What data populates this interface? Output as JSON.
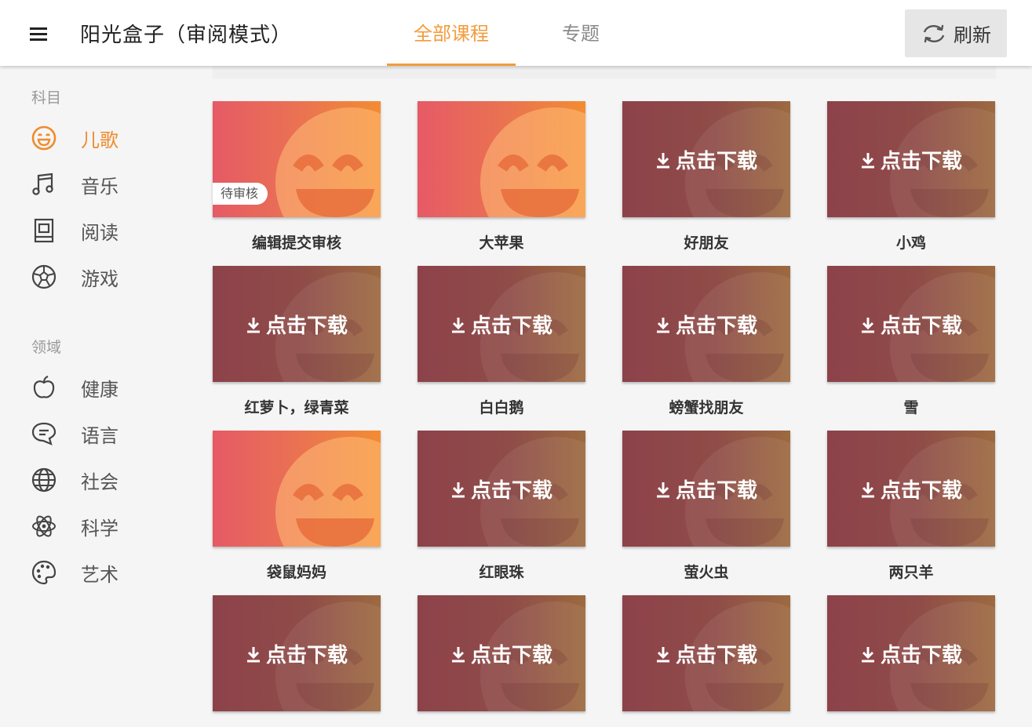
{
  "header": {
    "title": "阳光盒子（审阅模式）",
    "tabs": [
      {
        "label": "全部课程",
        "active": true
      },
      {
        "label": "专题",
        "active": false
      }
    ],
    "refresh_label": "刷新"
  },
  "sidebar": {
    "subjects_title": "科目",
    "subjects": [
      {
        "label": "儿歌",
        "icon": "smile-icon",
        "active": true
      },
      {
        "label": "音乐",
        "icon": "music-note-icon",
        "active": false
      },
      {
        "label": "阅读",
        "icon": "book-icon",
        "active": false
      },
      {
        "label": "游戏",
        "icon": "soccer-ball-icon",
        "active": false
      }
    ],
    "domains_title": "领域",
    "domains": [
      {
        "label": "健康",
        "icon": "apple-icon"
      },
      {
        "label": "语言",
        "icon": "chat-bubble-icon"
      },
      {
        "label": "社会",
        "icon": "globe-icon"
      },
      {
        "label": "科学",
        "icon": "atom-icon"
      },
      {
        "label": "艺术",
        "icon": "palette-icon"
      }
    ]
  },
  "download_label": "点击下载",
  "colors": {
    "accent": "#f39c3b"
  },
  "courses": [
    {
      "title": "编辑提交审核",
      "state": "ready",
      "badge": "待审核"
    },
    {
      "title": "大苹果",
      "state": "ready"
    },
    {
      "title": "好朋友",
      "state": "download"
    },
    {
      "title": "小鸡",
      "state": "download"
    },
    {
      "title": "红萝卜，绿青菜",
      "state": "download"
    },
    {
      "title": "白白鹅",
      "state": "download"
    },
    {
      "title": "螃蟹找朋友",
      "state": "download"
    },
    {
      "title": "雪",
      "state": "download"
    },
    {
      "title": "袋鼠妈妈",
      "state": "ready"
    },
    {
      "title": "红眼珠",
      "state": "download"
    },
    {
      "title": "萤火虫",
      "state": "download"
    },
    {
      "title": "两只羊",
      "state": "download"
    },
    {
      "title": "",
      "state": "download"
    },
    {
      "title": "",
      "state": "download"
    },
    {
      "title": "",
      "state": "download"
    },
    {
      "title": "",
      "state": "download"
    }
  ]
}
